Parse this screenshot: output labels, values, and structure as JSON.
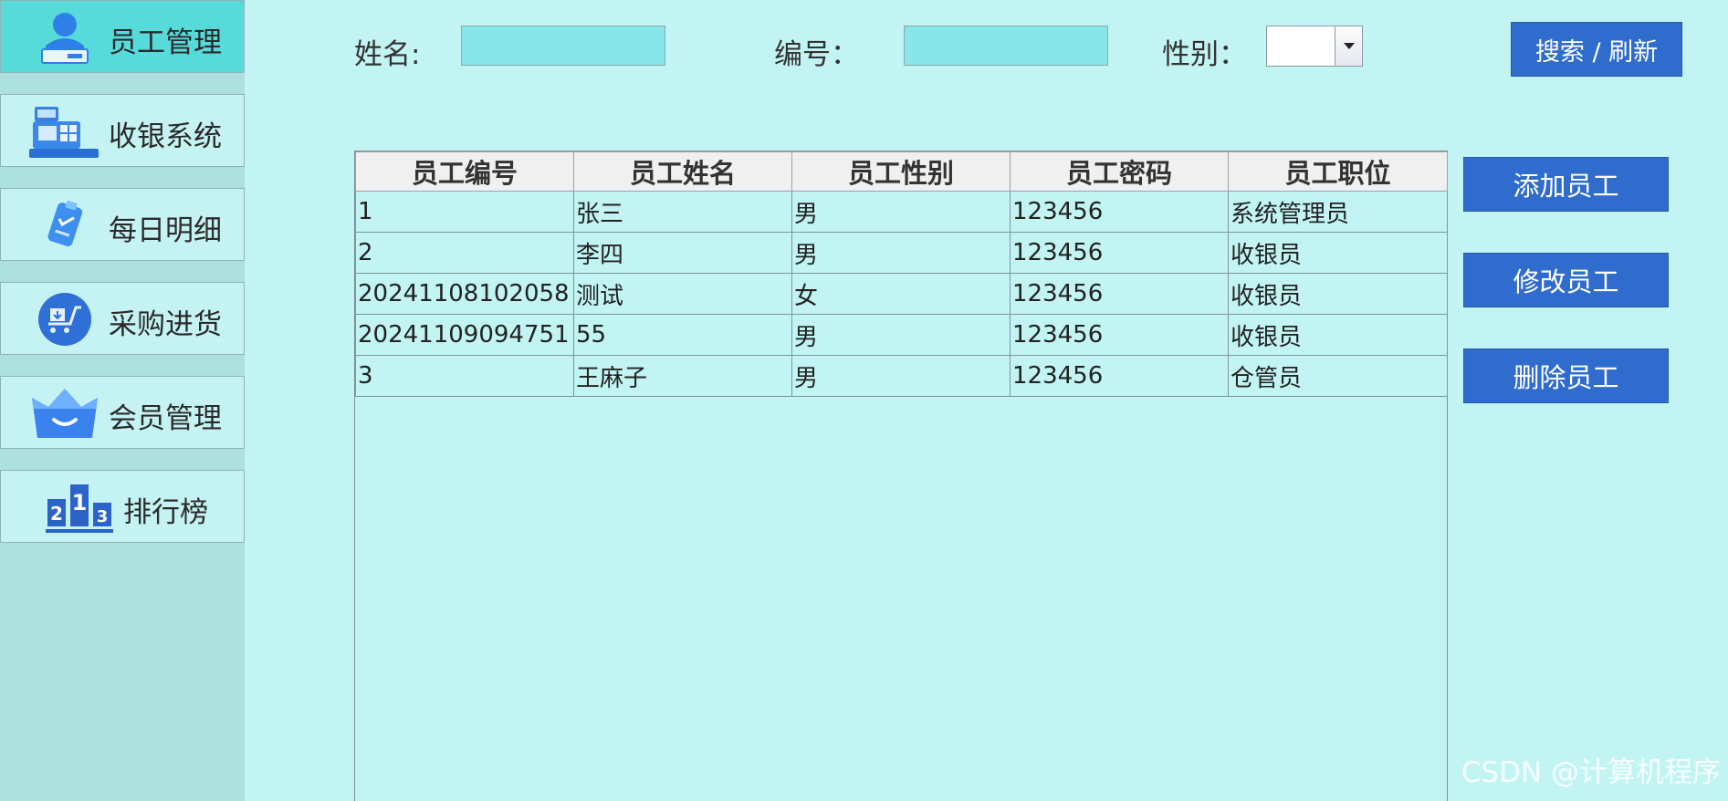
{
  "sidebar": {
    "items": [
      {
        "label": "员工管理",
        "icon": "employee-icon",
        "active": true
      },
      {
        "label": "收银系统",
        "icon": "cash-register-icon",
        "active": false
      },
      {
        "label": "每日明细",
        "icon": "clipboard-icon",
        "active": false
      },
      {
        "label": "采购进货",
        "icon": "purchase-cart-icon",
        "active": false
      },
      {
        "label": "会员管理",
        "icon": "crown-icon",
        "active": false
      },
      {
        "label": "排行榜",
        "icon": "podium-rank-icon",
        "active": false
      }
    ]
  },
  "search": {
    "name_label": "姓名:",
    "name_value": "",
    "id_label": "编号：",
    "id_value": "",
    "gender_label": "性别：",
    "gender_value": "",
    "search_button": "搜索 / 刷新"
  },
  "actions": {
    "add": "添加员工",
    "edit": "修改员工",
    "delete": "删除员工"
  },
  "table": {
    "columns": [
      "员工编号",
      "员工姓名",
      "员工性别",
      "员工密码",
      "员工职位"
    ],
    "rows": [
      [
        "1",
        "张三",
        "男",
        "123456",
        "系统管理员"
      ],
      [
        "2",
        "李四",
        "男",
        "123456",
        "收银员"
      ],
      [
        "20241108102058",
        "测试",
        "女",
        "123456",
        "收银员"
      ],
      [
        "20241109094751",
        "55",
        "男",
        "123456",
        "收银员"
      ],
      [
        "3",
        "王麻子",
        "男",
        "123456",
        "仓管员"
      ]
    ]
  },
  "watermark": "CSDN @计算机程序",
  "colors": {
    "background": "#c2f4f3",
    "sidebar": "#aee0e0",
    "active_nav": "#57dada",
    "button": "#2f6ccd",
    "input": "#88e6e8"
  }
}
